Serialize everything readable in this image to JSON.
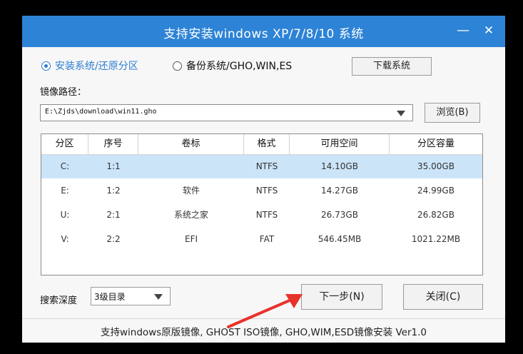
{
  "window": {
    "title": "支持安装windows XP/7/8/10 系统",
    "minimize_symbol": "—",
    "close_symbol": "✕",
    "titlebar_color": "#2d83d6"
  },
  "mode": {
    "install_label": "安装系统/还原分区",
    "backup_label": "备份系统/GHO,WIN,ES",
    "selected": "install",
    "download_button": "下载系统"
  },
  "image_path": {
    "label": "镜像路径：",
    "value": "E:\\Zjds\\download\\win11.gho",
    "browse_button": "浏览(B)"
  },
  "table": {
    "columns": [
      "分区",
      "序号",
      "卷标",
      "格式",
      "可用空间",
      "分区容量"
    ],
    "rows": [
      [
        "C:",
        "1:1",
        "",
        "NTFS",
        "14.10GB",
        "35.00GB"
      ],
      [
        "E:",
        "1:2",
        "软件",
        "NTFS",
        "14.27GB",
        "24.99GB"
      ],
      [
        "U:",
        "2:1",
        "系统之家",
        "NTFS",
        "26.73GB",
        "26.82GB"
      ],
      [
        "V:",
        "2:2",
        "EFI",
        "FAT",
        "546.45MB",
        "1021.22MB"
      ]
    ],
    "selected_row": 0,
    "selected_color": "#cce4f8"
  },
  "search_depth": {
    "label": "搜索深度",
    "value": "3级目录"
  },
  "actions": {
    "next_button": "下一步(N)",
    "close_button": "关闭(C)"
  },
  "footer": {
    "text": "支持windows原版镜像, GHOST ISO镜像, GHO,WIM,ESD镜像安装 Ver1.0"
  },
  "annotation": {
    "arrow_color": "#e8322a"
  }
}
